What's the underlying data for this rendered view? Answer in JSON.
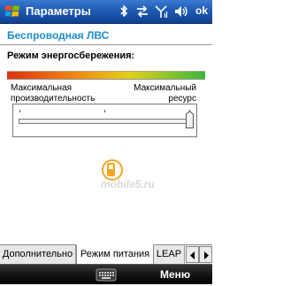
{
  "titlebar": {
    "title": "Параметры",
    "ok_label": "ok",
    "icons": [
      "windows-start-icon",
      "bluetooth-icon",
      "connectivity-icon",
      "signal-icon",
      "volume-icon"
    ]
  },
  "header": {
    "title": "Беспроводная ЛВС"
  },
  "power_saving": {
    "label": "Режим энергосбережения:",
    "gradient_colors": [
      "#e03010",
      "#ee8a12",
      "#e2d21a",
      "#38b83a"
    ],
    "left_label_line1": "Максимальная",
    "left_label_line2": "производительность",
    "right_label_line1": "Максимальный",
    "right_label_line2": "ресурс",
    "slider_value": 1.0
  },
  "watermark": {
    "text": "mobile5.ru"
  },
  "tabs": [
    {
      "label": "Дополнительно",
      "active": false
    },
    {
      "label": "Режим питания",
      "active": true
    },
    {
      "label": "LEAP",
      "active": false
    }
  ],
  "menubar": {
    "right_label": "Меню"
  },
  "colors": {
    "accent": "#1f8fc7",
    "titlebar": "#1f5bb5",
    "menubar": "#151515"
  }
}
